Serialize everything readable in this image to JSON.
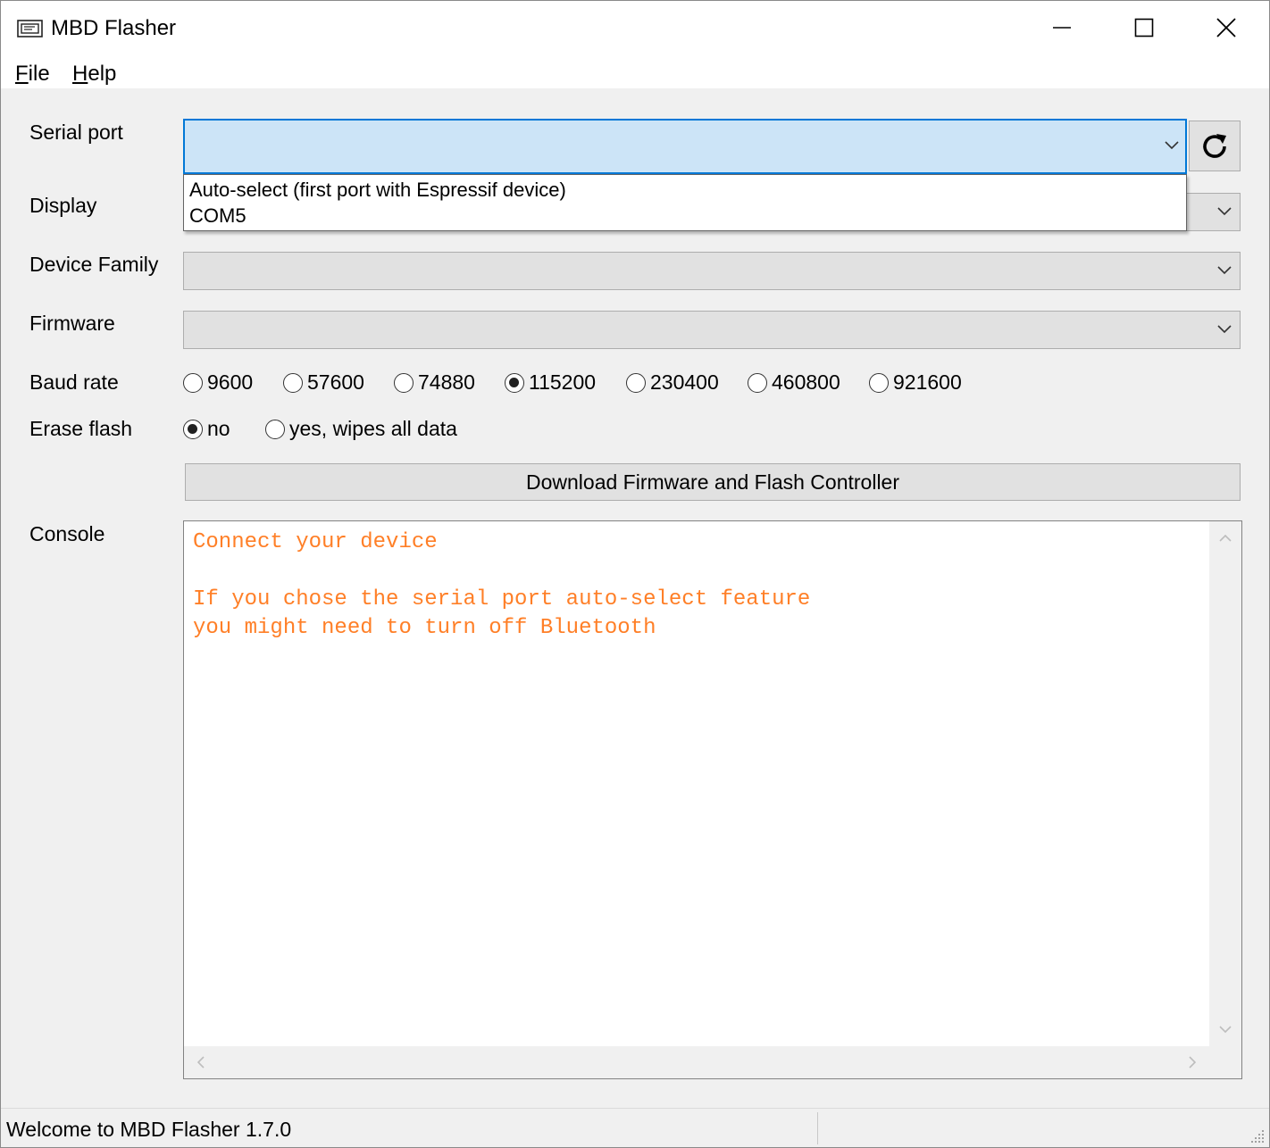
{
  "window": {
    "title": "MBD Flasher",
    "icon": "app-icon"
  },
  "menu": {
    "file": {
      "mnemonic": "F",
      "rest": "ile"
    },
    "help": {
      "mnemonic": "H",
      "rest": "elp"
    }
  },
  "form": {
    "serial_port_label": "Serial port",
    "serial_port_value": "",
    "serial_port_options": [
      "Auto-select (first port with Espressif device)",
      "COM5"
    ],
    "display_label": "Display",
    "device_family_label": "Device Family",
    "firmware_label": "Firmware",
    "baud_label": "Baud rate",
    "baud_options": [
      "9600",
      "57600",
      "74880",
      "115200",
      "230400",
      "460800",
      "921600"
    ],
    "baud_selected": "115200",
    "erase_label": "Erase flash",
    "erase_options": [
      "no",
      "yes, wipes all data"
    ],
    "erase_selected": "no",
    "flash_button": "Download Firmware and Flash Controller",
    "console_label": "Console"
  },
  "console": {
    "lines": [
      "Connect your device",
      "",
      "If you chose the serial port auto-select feature",
      "you might need to turn off Bluetooth"
    ],
    "text_color": "#ff7f27"
  },
  "status": {
    "text": "Welcome to MBD Flasher 1.7.0"
  },
  "colors": {
    "accent": "#0078d7",
    "selection_bg": "#cce4f7"
  }
}
